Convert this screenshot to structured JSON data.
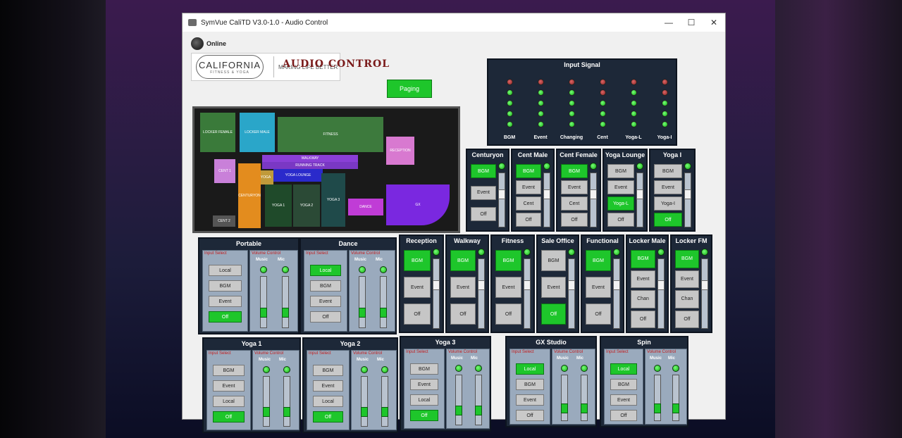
{
  "window": {
    "title": "SymVue CaliTD V3.0-1.0 - Audio Control",
    "minimize": "—",
    "maximize": "☐",
    "close": "✕"
  },
  "header": {
    "status": "Online",
    "logo_brand": "CALIFORNIA",
    "logo_sub": "FITNESS & YOGA",
    "logo_tagline": "MAKING LIFE BETTER",
    "title": "AUDIO CONTROL",
    "paging_label": "Paging"
  },
  "map": {
    "zones": [
      "LOCKER FEMALE",
      "LOCKER MALE",
      "FITNESS",
      "RECEPTION",
      "WALKWAY",
      "RUNNING TRACK",
      "CENT 1",
      "YOGA",
      "YOGA LOUNGE",
      "CENTURYON",
      "YOGA 1",
      "YOGA 2",
      "YOGA 3",
      "DANCE",
      "GX",
      "CENT 2"
    ]
  },
  "input_signal": {
    "title": "Input Signal",
    "channels": [
      {
        "label": "BGM",
        "levels": [
          "off",
          "g",
          "g",
          "g",
          "g"
        ]
      },
      {
        "label": "Event",
        "levels": [
          "off",
          "g",
          "g",
          "g",
          "g"
        ]
      },
      {
        "label": "Changing",
        "levels": [
          "off",
          "g",
          "g",
          "g",
          "g"
        ]
      },
      {
        "label": "Cent",
        "levels": [
          "off",
          "off",
          "g",
          "g",
          "g"
        ]
      },
      {
        "label": "Yoga-L",
        "levels": [
          "off",
          "g",
          "g",
          "g",
          "g"
        ]
      },
      {
        "label": "Yoga-I",
        "levels": [
          "off",
          "off",
          "g",
          "g",
          "g"
        ]
      }
    ]
  },
  "zones_row1": [
    {
      "name": "Centuryon",
      "buttons": [
        "BGM",
        "Event",
        "Off"
      ],
      "active": 0
    },
    {
      "name": "Cent Male",
      "buttons": [
        "BGM",
        "Event",
        "Cent",
        "Off"
      ],
      "active": 0
    },
    {
      "name": "Cent Female",
      "buttons": [
        "BGM",
        "Event",
        "Cent",
        "Off"
      ],
      "active": 0
    },
    {
      "name": "Yoga Lounge",
      "buttons": [
        "BGM",
        "Event",
        "Yoga-L",
        "Off"
      ],
      "active": 2
    },
    {
      "name": "Yoga I",
      "buttons": [
        "BGM",
        "Event",
        "Yoga-I",
        "Off"
      ],
      "active": 3
    }
  ],
  "zones_row2": [
    {
      "name": "Reception",
      "buttons": [
        "BGM",
        "Event",
        "Off"
      ],
      "active": 0
    },
    {
      "name": "Walkway",
      "buttons": [
        "BGM",
        "Event",
        "Off"
      ],
      "active": 0
    },
    {
      "name": "Fitness",
      "buttons": [
        "BGM",
        "Event",
        "Off"
      ],
      "active": 0
    },
    {
      "name": "Sale Office",
      "buttons": [
        "BGM",
        "Event",
        "Off"
      ],
      "active": 2
    },
    {
      "name": "Functional",
      "buttons": [
        "BGM",
        "Event",
        "Off"
      ],
      "active": 0
    },
    {
      "name": "Locker Male",
      "buttons": [
        "BGM",
        "Event",
        "Chan",
        "Off"
      ],
      "active": 0
    },
    {
      "name": "Locker FM",
      "buttons": [
        "BGM",
        "Event",
        "Chan",
        "Off"
      ],
      "active": 0
    }
  ],
  "mixers": [
    {
      "name": "Portable",
      "buttons": [
        "Local",
        "BGM",
        "Event",
        "Off"
      ],
      "active": 3
    },
    {
      "name": "Dance",
      "buttons": [
        "Local",
        "BGM",
        "Event",
        "Off"
      ],
      "active": 0
    },
    {
      "name": "Yoga 1",
      "buttons": [
        "BGM",
        "Event",
        "Local",
        "Off"
      ],
      "active": 3
    },
    {
      "name": "Yoga 2",
      "buttons": [
        "BGM",
        "Event",
        "Local",
        "Off"
      ],
      "active": 3
    },
    {
      "name": "Yoga 3",
      "buttons": [
        "BGM",
        "Event",
        "Local",
        "Off"
      ],
      "active": 3
    },
    {
      "name": "GX Studio",
      "buttons": [
        "Local",
        "BGM",
        "Event",
        "Off"
      ],
      "active": 0
    },
    {
      "name": "Spin",
      "buttons": [
        "Local",
        "BGM",
        "Event",
        "Off"
      ],
      "active": 0
    }
  ],
  "labels": {
    "input_select": "Input Select",
    "volume_control": "Volume Control",
    "music": "Music",
    "mic": "Mic"
  }
}
